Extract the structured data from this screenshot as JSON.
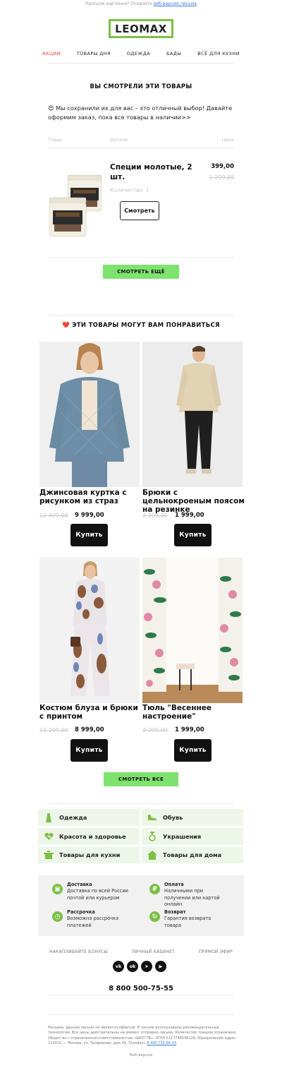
{
  "preheader": {
    "text": "Пропали картинки? Откройте",
    "link": "веб-версию письма"
  },
  "logo": "LEOMAX",
  "nav": [
    "АКЦИИ",
    "ТОВАРЫ ДНЯ",
    "ОДЕЖДА",
    "БАДЫ",
    "ВСЁ ДЛЯ КУХНИ"
  ],
  "viewed": {
    "title": "ВЫ СМОТРЕЛИ ЭТИ ТОВАРЫ",
    "intro": "😍 Мы сохранили их для вас – это отличный выбор! Давайте оформим заказ, пока все товары в наличии>>",
    "col_product": "Товар",
    "col_details": "Детали",
    "col_price": "Цена",
    "product": {
      "name": "Специи молотые, 2 шт.",
      "price": "399,00",
      "old_price": "1 299,00",
      "qty": "Количество: 1",
      "button": "Смотреть"
    },
    "more_button": "СМОТРЕТЬ ЕЩЁ"
  },
  "recommend": {
    "title": "❤️ ЭТИ ТОВАРЫ МОГУТ ВАМ ПОНРАВИТЬСЯ",
    "items": [
      {
        "name": "Джинсовая куртка с рисунком из страз",
        "old": "12 499,00",
        "price": "9 999,00",
        "button": "Купить"
      },
      {
        "name": "Брюки с цельнокроеным поясом на резинке",
        "old": "2 399,00",
        "price": "1 999,00",
        "button": "Купить"
      },
      {
        "name": "Костюм блуза и брюки с принтом",
        "old": "11 299,00",
        "price": "8 999,00",
        "button": "Купить"
      },
      {
        "name": "Тюль \"Весеннее настроение\"",
        "old": "3 299,00",
        "price": "1 999,00",
        "button": "Купить"
      }
    ],
    "all_button": "СМОТРЕТЬ ВСЕ"
  },
  "categories": [
    {
      "label": "Одежда",
      "icon": "dress-icon"
    },
    {
      "label": "Обувь",
      "icon": "shoe-icon"
    },
    {
      "label": "Красота и здоровье",
      "icon": "heart-health-icon"
    },
    {
      "label": "Украшения",
      "icon": "ring-icon"
    },
    {
      "label": "Товары для кухни",
      "icon": "pot-icon"
    },
    {
      "label": "Товары для дома",
      "icon": "house-icon"
    }
  ],
  "info": [
    {
      "title": "Доставка",
      "text": "Доставка по всей России почтой или курьером"
    },
    {
      "title": "Оплата",
      "text": "Наличными при получении или картой онлайн"
    },
    {
      "title": "Рассрочка",
      "text": "Возможна рассрочка платежей"
    },
    {
      "title": "Возврат",
      "text": "Гарантия возврата товара"
    }
  ],
  "footer_links": [
    "НАКАПЛИВАЙТЕ БОНУСЫ",
    "ЛИЧНЫЙ КАБИНЕТ",
    "ПРЯМОЙ ЭФИР"
  ],
  "socials": [
    "vk",
    "ok",
    "tg",
    "yt"
  ],
  "phone": "8 800 500-75-55",
  "legal": {
    "line1": "Реклама. Данное письмо не является офертой. В письме использованы рекомендательные технологии. Все цены действительны на момент отправки письма. Количество товаров ограничено. Общество с ограниченной ответственностью «ШОП ТВ». ОГРН 5117746036128.",
    "line2": "Юридический адрес: 115432, г. Москва, ул. Трофимова, дом 24. Телефон:",
    "phone_link": "8 495 733-96-03"
  },
  "web_version": "Веб-версия",
  "colors": {
    "accent": "#7bc043",
    "button_green": "#7ee26f",
    "nav_active": "#e53935"
  }
}
